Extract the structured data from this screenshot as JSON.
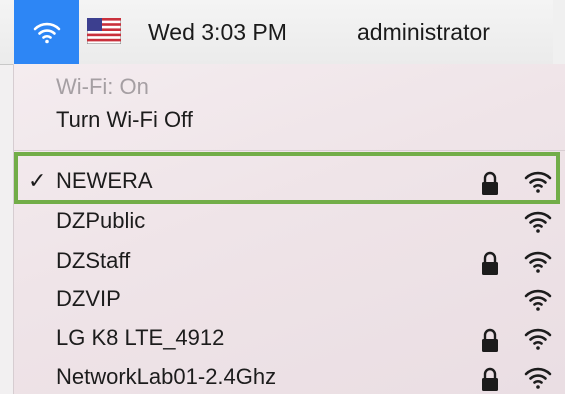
{
  "menubar": {
    "wifi_icon": "wifi-icon",
    "flag_icon": "us-flag-icon",
    "clock": "Wed 3:03 PM",
    "user": "administrator"
  },
  "wifi_menu": {
    "status": "Wi-Fi: On",
    "toggle_label": "Turn Wi-Fi Off",
    "networks": [
      {
        "name": "NEWERA",
        "connected": true,
        "locked": true,
        "checkmark": "✓"
      },
      {
        "name": "DZPublic",
        "connected": false,
        "locked": false
      },
      {
        "name": "DZStaff",
        "connected": false,
        "locked": true
      },
      {
        "name": "DZVIP",
        "connected": false,
        "locked": false
      },
      {
        "name": "LG K8 LTE_4912",
        "connected": false,
        "locked": true
      },
      {
        "name": "NetworkLab01-2.4Ghz",
        "connected": false,
        "locked": true
      }
    ]
  },
  "colors": {
    "accent": "#2d86f5",
    "highlight_border": "#72ad48",
    "disabled_text": "#a59fa3"
  }
}
